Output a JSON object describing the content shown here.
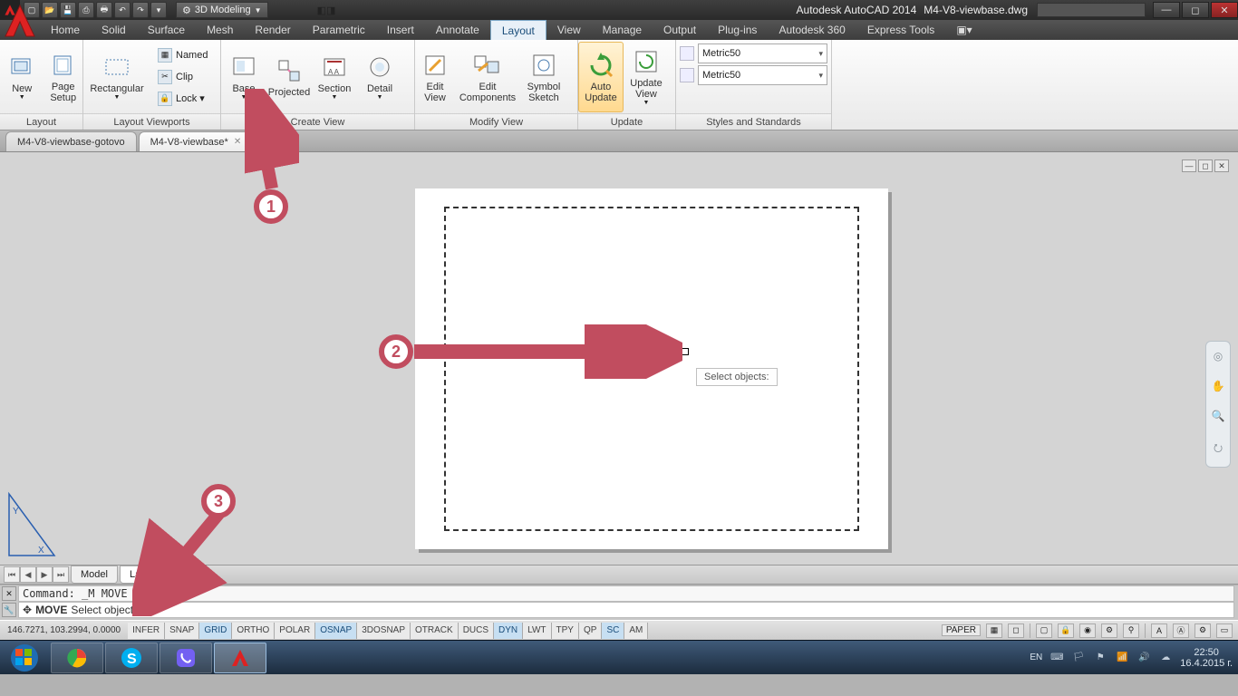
{
  "title": {
    "app": "Autodesk AutoCAD 2014",
    "file": "M4-V8-viewbase.dwg"
  },
  "workspace": "3D Modeling",
  "menu": [
    "Home",
    "Solid",
    "Surface",
    "Mesh",
    "Render",
    "Parametric",
    "Insert",
    "Annotate",
    "Layout",
    "View",
    "Manage",
    "Output",
    "Plug-ins",
    "Autodesk 360",
    "Express Tools"
  ],
  "menu_active": "Layout",
  "ribbon": {
    "panels": [
      {
        "name": "Layout",
        "items": [
          {
            "label": "New",
            "sub": "▾"
          },
          {
            "label": "Page\nSetup"
          }
        ]
      },
      {
        "name": "Layout Viewports",
        "items": [
          {
            "label": "Rectangular",
            "sub": "▾"
          }
        ],
        "side": [
          "Named",
          "Clip",
          "Lock ▾"
        ]
      },
      {
        "name": "Create View",
        "items": [
          {
            "label": "Base",
            "sub": "▾"
          },
          {
            "label": "Projected"
          },
          {
            "label": "Section",
            "sub": "▾"
          },
          {
            "label": "Detail",
            "sub": "▾"
          }
        ]
      },
      {
        "name": "Modify View",
        "items": [
          {
            "label": "Edit\nView"
          },
          {
            "label": "Edit\nComponents"
          },
          {
            "label": "Symbol\nSketch"
          }
        ]
      },
      {
        "name": "Update",
        "items": [
          {
            "label": "Auto\nUpdate",
            "active": true
          },
          {
            "label": "Update\nView",
            "sub": "▾"
          }
        ]
      },
      {
        "name": "Styles and Standards",
        "dropdowns": [
          "Metric50",
          "Metric50"
        ]
      }
    ]
  },
  "doctabs": [
    {
      "label": "M4-V8-viewbase-gotovo",
      "active": false
    },
    {
      "label": "M4-V8-viewbase* ",
      "active": true
    }
  ],
  "canvas": {
    "tooltip": "Select objects:"
  },
  "layouttabs": [
    "Model",
    "Layout2"
  ],
  "layouttab_active": "Layout2",
  "cmd": {
    "history": "Command: _M MOVE",
    "prompt_cmd": "MOVE",
    "prompt_rest": "Select objects:"
  },
  "status": {
    "coords": "146.7271, 103.2994, 0.0000",
    "toggles": [
      {
        "t": "INFER",
        "on": false
      },
      {
        "t": "SNAP",
        "on": false
      },
      {
        "t": "GRID",
        "on": true
      },
      {
        "t": "ORTHO",
        "on": false
      },
      {
        "t": "POLAR",
        "on": false
      },
      {
        "t": "OSNAP",
        "on": true
      },
      {
        "t": "3DOSNAP",
        "on": false
      },
      {
        "t": "OTRACK",
        "on": false
      },
      {
        "t": "DUCS",
        "on": false
      },
      {
        "t": "DYN",
        "on": true
      },
      {
        "t": "LWT",
        "on": false
      },
      {
        "t": "TPY",
        "on": false
      },
      {
        "t": "QP",
        "on": false
      },
      {
        "t": "SC",
        "on": true
      },
      {
        "t": "AM",
        "on": false
      }
    ],
    "space": "PAPER"
  },
  "tray": {
    "lang": "EN",
    "time": "22:50",
    "date": "16.4.2015 г."
  },
  "callouts": [
    "1",
    "2",
    "3"
  ]
}
